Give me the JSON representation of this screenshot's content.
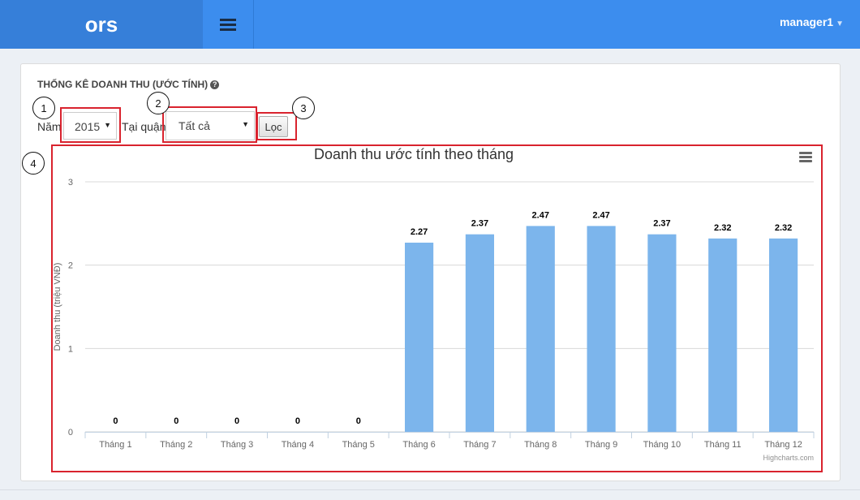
{
  "header": {
    "logo": "ors",
    "user": "manager1"
  },
  "filters": {
    "title": "THỐNG KÊ DOANH THU (ƯỚC TÍNH)",
    "year_label": "Năm",
    "year_value": "2015",
    "district_label": "Tại quận",
    "district_value": "Tất cả",
    "filter_button": "Lọc"
  },
  "markers": [
    "1",
    "2",
    "3",
    "4"
  ],
  "chart_data": {
    "type": "bar",
    "title": "Doanh thu ước tính theo tháng",
    "ylabel": "Doanh thu (triệu VNĐ)",
    "xlabel": "",
    "categories": [
      "Tháng 1",
      "Tháng 2",
      "Tháng 3",
      "Tháng 4",
      "Tháng 5",
      "Tháng 6",
      "Tháng 7",
      "Tháng 8",
      "Tháng 9",
      "Tháng 10",
      "Tháng 11",
      "Tháng 12"
    ],
    "values": [
      0,
      0,
      0,
      0,
      0,
      2.27,
      2.37,
      2.47,
      2.47,
      2.37,
      2.32,
      2.32
    ],
    "ylim": [
      0,
      3
    ],
    "yticks": [
      0,
      1,
      2,
      3
    ],
    "grid": true,
    "legend": "none",
    "bar_color": "#7cb5ec",
    "credits": "Highcharts.com"
  }
}
